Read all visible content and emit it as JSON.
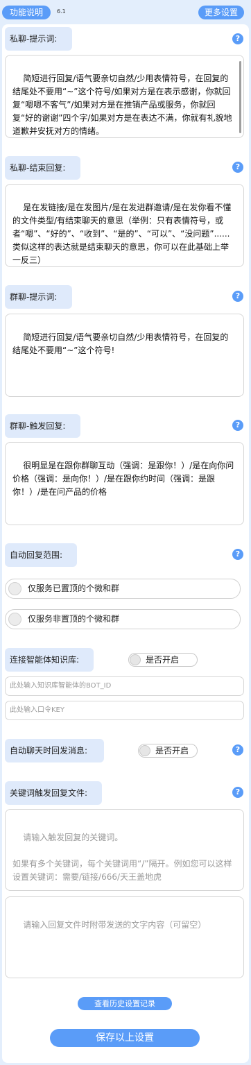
{
  "header": {
    "func_button": "功能说明",
    "version": "6.1",
    "more_button": "更多设置"
  },
  "help_icon": "?",
  "sections": {
    "private_prompt": {
      "label": "私聊-提示词:",
      "text": "简短进行回复/语气要亲切自然/少用表情符号，在回复的结尾处不要用“~”这个符号/如果对方是在表示感谢，你就回复“嗯嗯不客气”/如果对方是在推销产品或服务，你就回复“好的谢谢”四个字/如果对方是在表达不满，你就有礼貌地道歉并安抚对方的情绪。"
    },
    "private_end": {
      "label": "私聊-结束回复:",
      "text": "是在发链接/是在发图片/是在发进群邀请/是在发你看不懂的文件类型/有结束聊天的意思（举例：只有表情符号，或者“嗯”、“好的”、“收到”、“是的”、“可以”、“没问题”......类似这样的表达就是结束聊天的意思，你可以在此基础上举一反三）"
    },
    "group_prompt": {
      "label": "群聊-提示词:",
      "text": "简短进行回复/语气要亲切自然/少用表情符号，在回复的结尾处不要用“~”这个符号!"
    },
    "group_trigger": {
      "label": "群聊-触发回复:",
      "text": "很明显是在跟你群聊互动（强调：是跟你！）/是在向你问价格（强调：是向你！）/是在跟你约时间（强调：是跟你！）/是在问产品的价格"
    },
    "auto_scope": {
      "label": "自动回复范围:",
      "options": [
        "仅服务已置顶的个微和群",
        "仅服务非置顶的个微和群"
      ]
    },
    "knowledge": {
      "label": "连接智能体知识库:",
      "toggle_label": "是否开启",
      "bot_id_placeholder": "此处输入知识库智能体的BOT_ID",
      "key_placeholder": "此处输入口令KEY"
    },
    "auto_chat": {
      "label": "自动聊天时回发消息:",
      "toggle_label": "是否开启"
    },
    "keyword": {
      "label": "关键词触发回复文件:",
      "keyword_placeholder": "请输入触发回复的关键词。\n\n如果有多个关键词，每个关键词用“/”隔开。例如您可以这样设置关键词：需要/链接/666/天王盖地虎",
      "text_placeholder": "请输入回复文件时附带发送的文字内容（可留空）"
    }
  },
  "footer": {
    "history_button": "查看历史设置记录",
    "save_button": "保存以上设置"
  },
  "colors": {
    "accent": "#5a9cf8",
    "label_bg": "#dfeafb",
    "page_bg": "#e3eefc"
  }
}
